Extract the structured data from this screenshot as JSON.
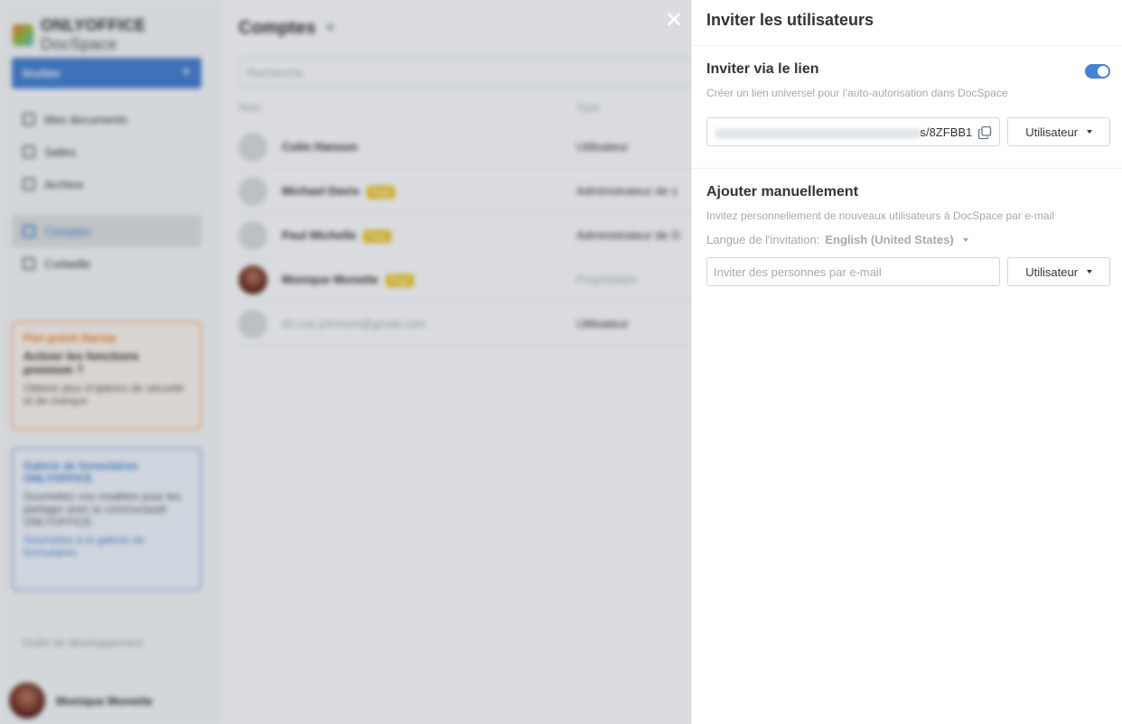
{
  "background": {
    "logo": {
      "brand": "ONLYOFFICE",
      "product": "DocSpace"
    },
    "invite_button": "Inviter",
    "nav": [
      {
        "label": "Mes documents",
        "icon": "user-icon"
      },
      {
        "label": "Salles",
        "icon": "rooms-icon"
      },
      {
        "label": "Archive",
        "icon": "archive-icon"
      },
      {
        "label": "Comptes",
        "icon": "accounts-icon"
      },
      {
        "label": "Corbeille",
        "icon": "trash-icon"
      }
    ],
    "promo": {
      "tag": "Plan gratuit Startup",
      "title": "Activer les fonctions premium ?",
      "text": "Obtenir plus d'options de sécurité et de marque"
    },
    "gallery": {
      "title": "Galerie de formulaires ONLYOFFICE",
      "text": "Soumettez vos modèles pour les partager avec la communauté ONLYOFFICE.",
      "link": "Soumettre à la galerie de formulaires"
    },
    "devtools": "Outils de développement",
    "profile_name": "Monique Monette",
    "main_title": "Comptes",
    "search_placeholder": "Recherche",
    "columns": {
      "name": "Nom",
      "type": "Type"
    },
    "rows": [
      {
        "name": "Colin Hanson",
        "tag": "",
        "type": "Utilisateur"
      },
      {
        "name": "Michael Davis",
        "tag": "Payé",
        "type": "Administrateur de s"
      },
      {
        "name": "Paul Michelle",
        "tag": "Payé",
        "type": "Administrateur de D"
      },
      {
        "name": "Monique Monette",
        "tag": "Payé",
        "type": "Propriétaire"
      },
      {
        "name": "eli.coe.johnson@gmail.com",
        "tag": "",
        "type": "Utilisateur"
      }
    ]
  },
  "panel": {
    "title": "Inviter les utilisateurs",
    "link_section": {
      "title": "Inviter via le lien",
      "description": "Créer un lien universel pour l’auto-autorisation dans DocSpace",
      "link_suffix": "s/8ZFBB1",
      "role": "Utilisateur",
      "toggle_on": true
    },
    "manual_section": {
      "title": "Ajouter manuellement",
      "description": "Invitez personnellement de nouveaux utilisateurs à DocSpace par e-mail",
      "language_label": "Langue de l'invitation:",
      "language_value": "English (United States)",
      "email_placeholder": "Inviter des personnes par e-mail",
      "role": "Utilisateur"
    }
  },
  "colors": {
    "accent": "#4781d1",
    "promo": "#ff7b31",
    "backdrop": "rgba(6,22,38,0.15)"
  }
}
